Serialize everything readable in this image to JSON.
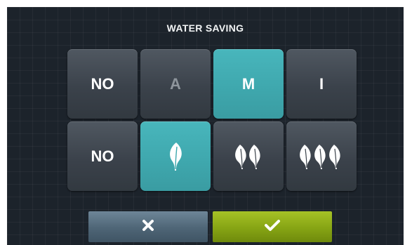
{
  "screen": {
    "title": "WATER SAVING"
  },
  "modes": [
    {
      "label": "NO",
      "state": "normal"
    },
    {
      "label": "A",
      "state": "disabled"
    },
    {
      "label": "M",
      "state": "selected"
    },
    {
      "label": "I",
      "state": "normal"
    }
  ],
  "levels": [
    {
      "label": "NO",
      "leaf_count": 0,
      "state": "normal"
    },
    {
      "label": "",
      "leaf_count": 1,
      "state": "selected"
    },
    {
      "label": "",
      "leaf_count": 2,
      "state": "normal"
    },
    {
      "label": "",
      "leaf_count": 3,
      "state": "normal"
    }
  ],
  "actions": {
    "cancel_icon": "close-icon",
    "confirm_icon": "check-icon"
  },
  "colors": {
    "background": "#1c232b",
    "tile": "#3b424b",
    "selected": "#3fa8ae",
    "cancel": "#4e6576",
    "confirm": "#86a414"
  }
}
